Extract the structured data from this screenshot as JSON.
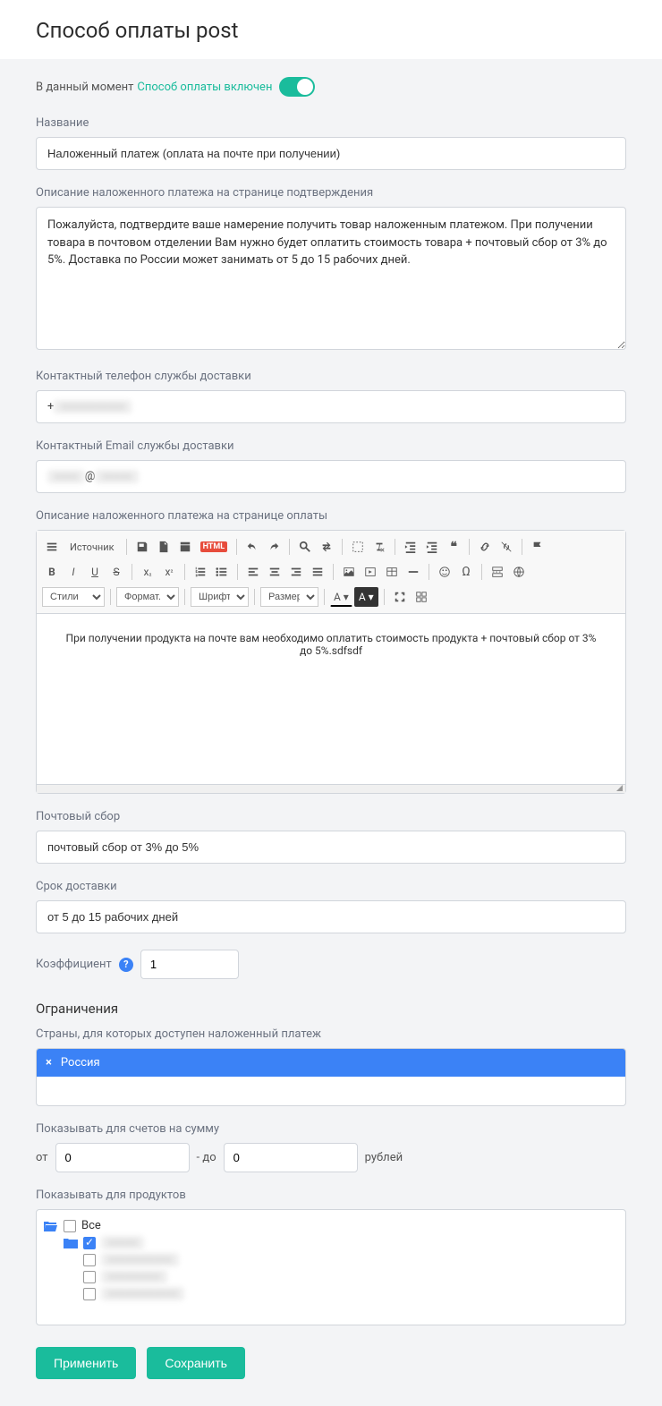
{
  "page_title": "Способ оплаты post",
  "toggle": {
    "prefix": "В данный момент ",
    "status": "Способ оплаты включен",
    "on": true
  },
  "fields": {
    "name": {
      "label": "Название",
      "value": "Наложенный платеж (оплата на почте при получении)"
    },
    "confirm_desc": {
      "label": "Описание наложенного платежа на странице подтверждения",
      "value": "Пожалуйста, подтвердите ваше намерение получить товар наложенным платежом. При получении товара в почтовом отделении Вам нужно будет оплатить стоимость товара + почтовый сбор от 3% до 5%. Доставка по России может занимать от 5 до 15 рабочих дней."
    },
    "phone": {
      "label": "Контактный телефон службы доставки",
      "value": "+"
    },
    "email": {
      "label": "Контактный Email службы доставки",
      "value": "@"
    },
    "pay_desc": {
      "label": "Описание наложенного платежа на странице оплаты",
      "value": "При получении продукта на почте вам необходимо оплатить стоимость продукта + почтовый сбор от 3% до 5%.sdfsdf"
    },
    "fee": {
      "label": "Почтовый сбор",
      "value": "почтовый сбор от 3% до 5%"
    },
    "delivery": {
      "label": "Срок доставки",
      "value": "от 5 до 15 рабочих дней"
    },
    "coeff": {
      "label": "Коэффициент",
      "value": "1",
      "help": "?"
    }
  },
  "restrictions": {
    "heading": "Ограничения",
    "countries_label": "Страны, для которых доступен наложенный платеж",
    "countries": [
      "Россия"
    ],
    "amount_label": "Показывать для счетов на сумму",
    "amount_from_label": "от",
    "amount_from": "0",
    "amount_to_label": "- до",
    "amount_to": "0",
    "amount_currency": "рублей",
    "products_label": "Показывать для продуктов",
    "tree_all": "Все"
  },
  "editor_toolbar": {
    "source": "Источник",
    "styles": "Стили",
    "format": "Формат...",
    "font": "Шрифт",
    "size": "Размер"
  },
  "buttons": {
    "apply": "Применить",
    "save": "Сохранить"
  }
}
